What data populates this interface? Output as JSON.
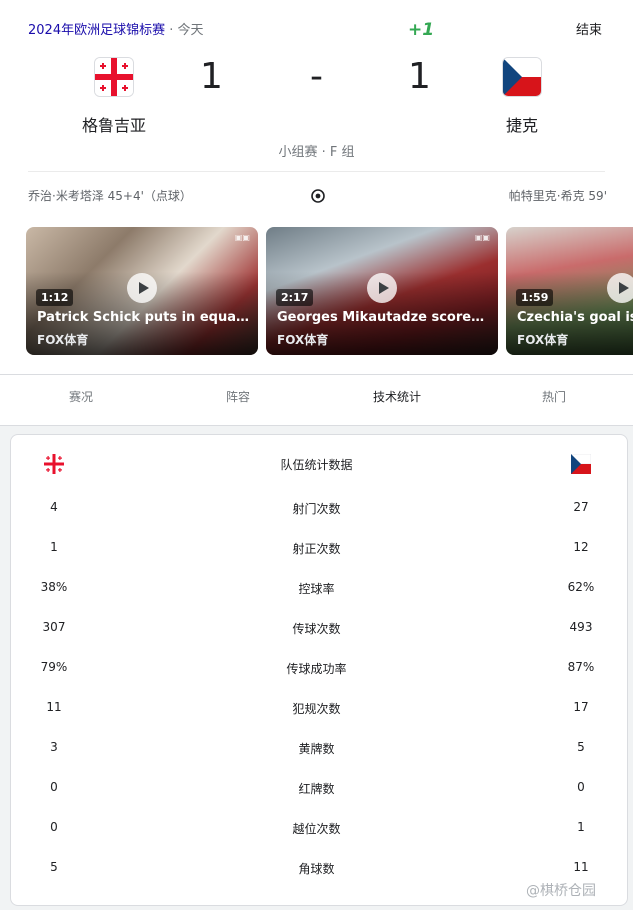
{
  "header": {
    "competition": "2024年欧洲足球锦标赛",
    "separator": "·",
    "day": "今天",
    "plus_badge": "+1",
    "status": "结束"
  },
  "match": {
    "home_team": "格鲁吉亚",
    "away_team": "捷克",
    "home_score": "1",
    "away_score": "1",
    "score_separator": "-",
    "stage": "小组赛 · F 组"
  },
  "scorers": {
    "home": "乔治·米考塔泽 45+4'（点球）",
    "away": "帕特里克·希克 59'"
  },
  "videos": [
    {
      "duration": "1:12",
      "title": "Patrick Schick puts in equalizer i...",
      "source": "FOX体育"
    },
    {
      "duration": "2:17",
      "title": "Georges Mikautadze scores on...",
      "source": "FOX体育"
    },
    {
      "duration": "1:59",
      "title": "Czechia's goal is d",
      "source": "FOX体育"
    }
  ],
  "tabs": [
    "赛况",
    "阵容",
    "技术统计",
    "热门"
  ],
  "active_tab": "技术统计",
  "stats": {
    "heading": "队伍统计数据",
    "rows": [
      {
        "label": "射门次数",
        "home": "4",
        "away": "27"
      },
      {
        "label": "射正次数",
        "home": "1",
        "away": "12"
      },
      {
        "label": "控球率",
        "home": "38%",
        "away": "62%"
      },
      {
        "label": "传球次数",
        "home": "307",
        "away": "493"
      },
      {
        "label": "传球成功率",
        "home": "79%",
        "away": "87%"
      },
      {
        "label": "犯规次数",
        "home": "11",
        "away": "17"
      },
      {
        "label": "黄牌数",
        "home": "3",
        "away": "5"
      },
      {
        "label": "红牌数",
        "home": "0",
        "away": "0"
      },
      {
        "label": "越位次数",
        "home": "0",
        "away": "1"
      },
      {
        "label": "角球数",
        "home": "5",
        "away": "11"
      }
    ]
  },
  "watermark": "@棋桥仓园",
  "colors": {
    "link": "#1a0dab",
    "plus": "#34a853",
    "georgia_red": "#e8112d",
    "czech_blue": "#11457e",
    "czech_red": "#d7141a"
  },
  "icons": {
    "ball": "soccer-ball-icon",
    "play": "play-icon",
    "georgia_flag": "georgia-flag-icon",
    "czech_flag": "czech-flag-icon"
  }
}
